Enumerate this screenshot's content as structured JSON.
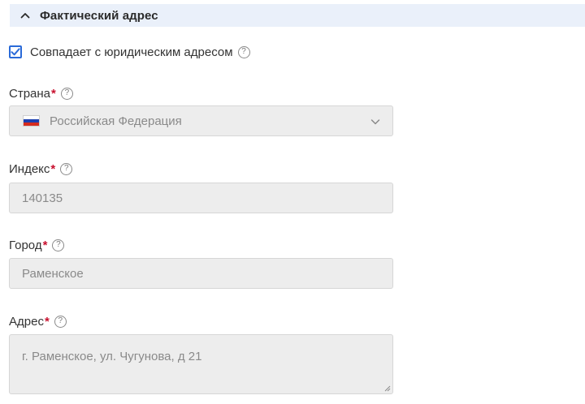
{
  "section": {
    "title": "Фактический адрес",
    "expanded": true
  },
  "same_as_legal": {
    "label": "Совпадает с юридическим адресом",
    "checked": true,
    "help": "?"
  },
  "country": {
    "label": "Страна",
    "required_mark": "*",
    "help": "?",
    "value": "Российская Федерация",
    "flag_icon": "russia-flag-icon",
    "flag_colors": [
      "#ffffff",
      "#1c3fb0",
      "#d52b1e"
    ]
  },
  "index": {
    "label": "Индекс",
    "required_mark": "*",
    "help": "?",
    "value": "140135"
  },
  "city": {
    "label": "Город",
    "required_mark": "*",
    "help": "?",
    "value": "Раменское"
  },
  "address": {
    "label": "Адрес",
    "required_mark": "*",
    "help": "?",
    "value": "г. Раменское, ул. Чугунова, д 21"
  },
  "colors": {
    "section_bg": "#eaf0fa",
    "checkbox_accent": "#2a6ad8",
    "required": "#c8102e",
    "field_bg": "#ededed",
    "field_text": "#8a8a8a"
  }
}
